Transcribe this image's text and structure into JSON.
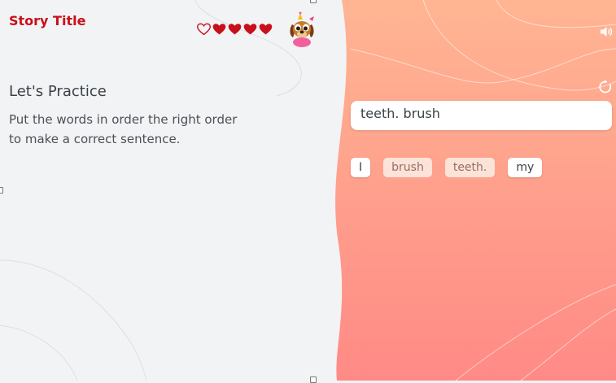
{
  "header": {
    "title": "Story Title",
    "lives_total": 5,
    "lives_filled": 4
  },
  "exercise": {
    "title": "Let's Practice",
    "instruction_line1": "Put the words in order the right order",
    "instruction_line2": "to make a correct sentence."
  },
  "answer": {
    "text": "teeth. brush"
  },
  "word_bank": [
    {
      "label": "I",
      "state": "available"
    },
    {
      "label": "brush",
      "state": "used"
    },
    {
      "label": "teeth.",
      "state": "used"
    },
    {
      "label": "my",
      "state": "available"
    }
  ],
  "colors": {
    "accent_red": "#c8101a",
    "left_background": "#f2f3f5",
    "gradient_top": "#ffb592",
    "gradient_bottom": "#ff8a86"
  },
  "icons": {
    "speaker": "speaker-icon",
    "refresh": "refresh-icon",
    "heart_empty": "heart-outline-icon",
    "heart_full": "heart-filled-icon",
    "avatar": "dog-character-avatar"
  }
}
